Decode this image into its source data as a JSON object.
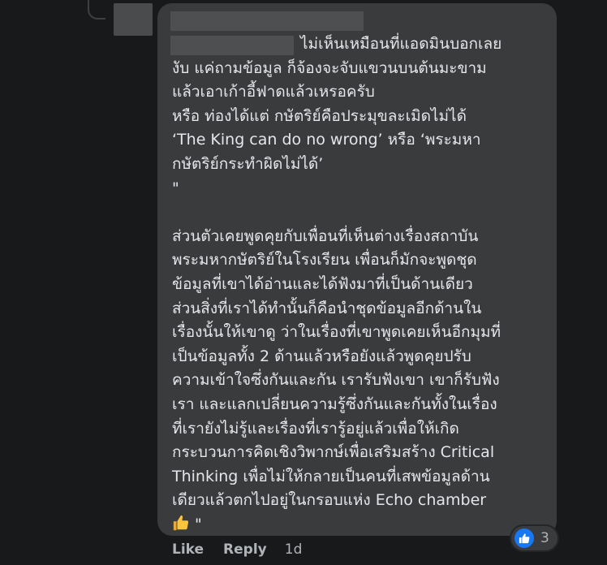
{
  "comment": {
    "author_redacted": true,
    "lines": [
      "ไม่เห็นเหมือนที่แอดมินบอกเลย",
      "งับ แค่ถามข้อมูล ก็จ้องจะจับแขวนบนต้นมะขาม",
      "แล้วเอาเก้าอี้ฟาดแล้วเหรอครับ",
      "หรือ ท่องได้แต่ กษัตริย์คือประมุขละเมิดไม่ได้",
      "‘The King can do no wrong’ หรือ ‘พระมหา",
      "กษัตริย์กระทำผิดไม่ได้’",
      "\"",
      "",
      "ส่วนตัวเคยพูดคุยกับเพื่อนที่เห็นต่างเรื่องสถาบัน",
      "พระมหากษัตริย์ในโรงเรียน เพื่อนก็มักจะพูดชุด",
      "ข้อมูลที่เขาได้อ่านและได้ฟังมาที่เป็นด้านเดียว",
      "ส่วนสิ่งที่เราได้ทำนั้นก็คือนำชุดข้อมูลอีกด้านใน",
      "เรื่องนั้นให้เขาดู ว่าในเรื่องที่เขาพูดเคยเห็นอีกมุมที่",
      "เป็นข้อมูลทั้ง 2 ด้านแล้วหรือยังแล้วพูดคุยปรับ",
      "ความเข้าใจซึ่งกันและกัน เรารับฟังเขา เขาก็รับฟัง",
      "เรา และแลกเปลี่ยนความรู้ซึ่งกันและกันทั้งในเรื่อง",
      "ที่เรายังไม่รู้และเรื่องที่เรารู้อยู่แล้วเพื่อให้เกิด",
      "กระบวนการคิดเชิงวิพากษ์เพื่อเสริมสร้าง Critical",
      "Thinking เพื่อไม่ให้กลายเป็นคนที่เสพข้อมูลด้าน",
      "เดียวแล้วตกไปอยู่ในกรอบแห่ง Echo chamber"
    ],
    "last_line_suffix": "\""
  },
  "actions": {
    "like_label": "Like",
    "reply_label": "Reply",
    "timestamp": "1d"
  },
  "reactions": {
    "icon": "thumbs-up-icon",
    "count": "3",
    "color": "#1877f2"
  },
  "colors": {
    "background": "#18191a",
    "bubble": "#3a3b3c",
    "text": "#e4e6eb",
    "secondary_text": "#b0b3b8"
  }
}
